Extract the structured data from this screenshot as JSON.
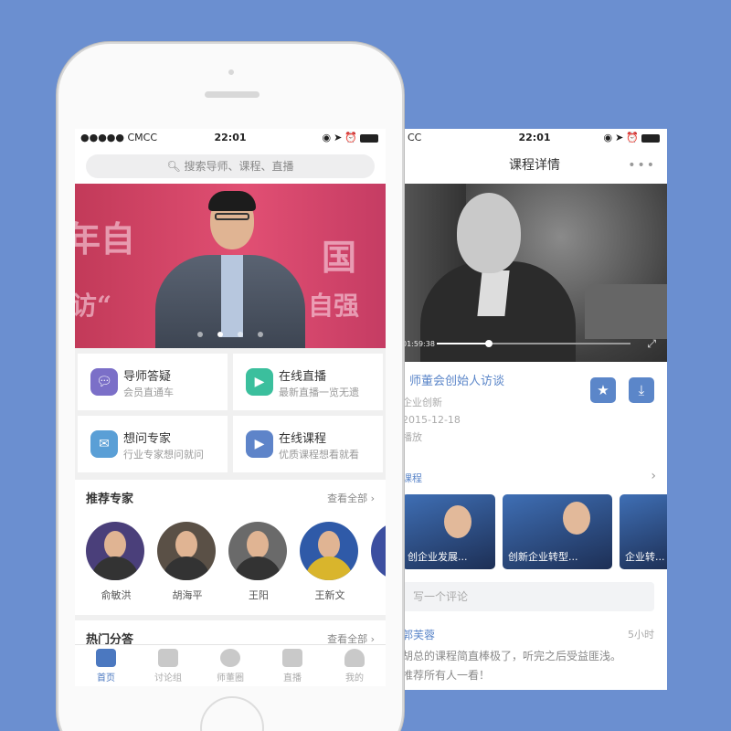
{
  "status_bar": {
    "carrier": "●●●●● CMCC",
    "carrier_short": "CC",
    "time": "22:01"
  },
  "detail": {
    "title": "课程详情",
    "more_icon": "•••",
    "video": {
      "time": "01:59:38",
      "progress": 0.27
    },
    "course_title": "师董会创始人访谈",
    "category": "企业创新",
    "date": "2015-12-18",
    "plays": "播放",
    "related_label": "课程",
    "related": [
      {
        "label": "创企业发展..."
      },
      {
        "label": "创新企业转型..."
      },
      {
        "label": "企业转..."
      }
    ],
    "comment_placeholder": "写一个评论",
    "comment": {
      "name": "郭芙蓉",
      "time": "5小时",
      "line1": "胡总的课程简直棒极了，听完之后受益匪浅。",
      "line2": "推荐所有人一看！"
    }
  },
  "home": {
    "search_placeholder": "搜索导师、课程、直播",
    "banner": {
      "text1": "年自",
      "text2": "国",
      "text3": "访“",
      "text4": "自强",
      "slide_count": 4,
      "active_slide": 1
    },
    "features": [
      {
        "title": "导师答疑",
        "subtitle": "会员直通车",
        "icon": "chat-icon",
        "color": "#7b6fc8"
      },
      {
        "title": "在线直播",
        "subtitle": "最新直播一览无遗",
        "icon": "video-icon",
        "color": "#3bbf9d"
      },
      {
        "title": "想问专家",
        "subtitle": "行业专家想问就问",
        "icon": "message-icon",
        "color": "#5a9fd6"
      },
      {
        "title": "在线课程",
        "subtitle": "优质课程想看就看",
        "icon": "play-icon",
        "color": "#5e84c9"
      }
    ],
    "experts_section": {
      "title": "推荐专家",
      "more": "查看全部"
    },
    "experts": [
      {
        "name": "俞敏洪"
      },
      {
        "name": "胡海平"
      },
      {
        "name": "王阳"
      },
      {
        "name": "王新文"
      }
    ],
    "qa_section": {
      "title": "热门分答",
      "more": "查看全部"
    },
    "tabs": [
      {
        "label": "首页",
        "icon": "home-icon"
      },
      {
        "label": "讨论组",
        "icon": "group-icon"
      },
      {
        "label": "师董圈",
        "icon": "compass-icon"
      },
      {
        "label": "直播",
        "icon": "camera-icon"
      },
      {
        "label": "我的",
        "icon": "user-icon"
      }
    ],
    "active_tab": 0
  }
}
